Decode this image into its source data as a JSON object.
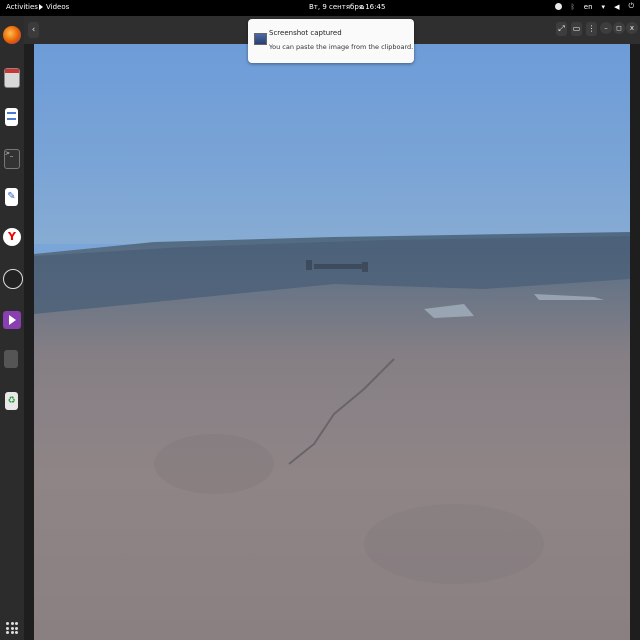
{
  "topbar": {
    "activities": "Activities",
    "app_name": "Videos",
    "clock": "Вт, 9 сентября  16:45",
    "language": "en"
  },
  "notification": {
    "title": "Screenshot captured",
    "body": "You can paste the image from the clipboard."
  },
  "window": {
    "back_label": "‹",
    "minimize_label": "–",
    "restore_label": "◻",
    "close_label": "x",
    "menu_label": "⋮"
  },
  "dock": {
    "items": [
      "firefox-icon",
      "files-icon",
      "document-viewer-icon",
      "terminal-icon",
      "text-editor-icon",
      "yandex-browser-icon",
      "obs-studio-icon",
      "videos-icon",
      "calculator-icon",
      "trash-icon"
    ]
  },
  "colors": {
    "topbar": "#000000",
    "dock": "#2c2c2c",
    "sky": "#7ba6d8",
    "ground": "#8b8383"
  }
}
